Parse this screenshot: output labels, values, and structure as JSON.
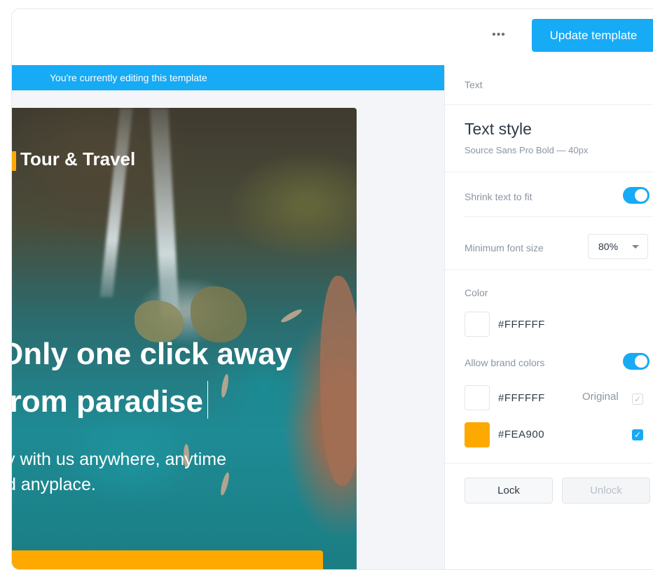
{
  "toolbar": {
    "more_glyph": "•••",
    "update_label": "Update template"
  },
  "canvas": {
    "banner": "You're currently editing this template",
    "poster": {
      "brand": "Tour & Travel",
      "headline_line1": "Only one click away",
      "headline_line2": "from paradise",
      "subline_line1": "y with us anywhere, anytime",
      "subline_line2": "d anyplace."
    }
  },
  "panel": {
    "section_label": "Text",
    "text_style_title": "Text style",
    "text_style_sub": "Source Sans Pro Bold — 40px",
    "shrink_label": "Shrink text to fit",
    "shrink_enabled": true,
    "min_font_label": "Minimum font size",
    "min_font_value": "80%",
    "color_label": "Color",
    "color_value": "#FFFFFF",
    "allow_brand_label": "Allow brand colors",
    "allow_brand_enabled": true,
    "brand_colors": [
      {
        "hex": "#FFFFFF",
        "tag": "Original",
        "checked": true
      },
      {
        "hex": "#FEA900",
        "tag": "",
        "checked": true
      }
    ],
    "lock_label": "Lock",
    "unlock_label": "Unlock"
  },
  "colors": {
    "accent": "#17AAF5",
    "brand_orange": "#FEA900"
  }
}
